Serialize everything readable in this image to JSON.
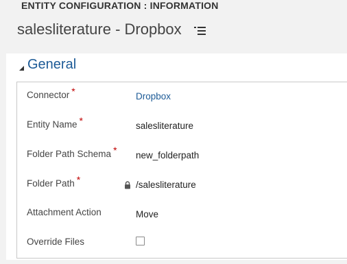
{
  "header": {
    "entity_label": "ENTITY CONFIGURATION : INFORMATION",
    "page_title": "salesliterature - Dropbox"
  },
  "section": {
    "title": "General"
  },
  "fields": {
    "connector": {
      "label": "Connector",
      "required_mark": "*",
      "value": "Dropbox"
    },
    "entity_name": {
      "label": "Entity Name",
      "required_mark": "*",
      "value": "salesliterature"
    },
    "folder_path_schema": {
      "label": "Folder Path Schema",
      "required_mark": "*",
      "value": "new_folderpath"
    },
    "folder_path": {
      "label": "Folder Path",
      "required_mark": "*",
      "value": "/salesliterature"
    },
    "attachment_action": {
      "label": "Attachment Action",
      "value": "Move"
    },
    "override_files": {
      "label": "Override Files",
      "checked": false
    }
  },
  "colors": {
    "accent": "#1c5a96",
    "required": "#c00000",
    "header_bg": "#f2f2f2"
  },
  "icons": {
    "title_menu": "list-menu-icon",
    "section_toggle": "collapse-triangle-icon",
    "lock": "lock-icon"
  }
}
